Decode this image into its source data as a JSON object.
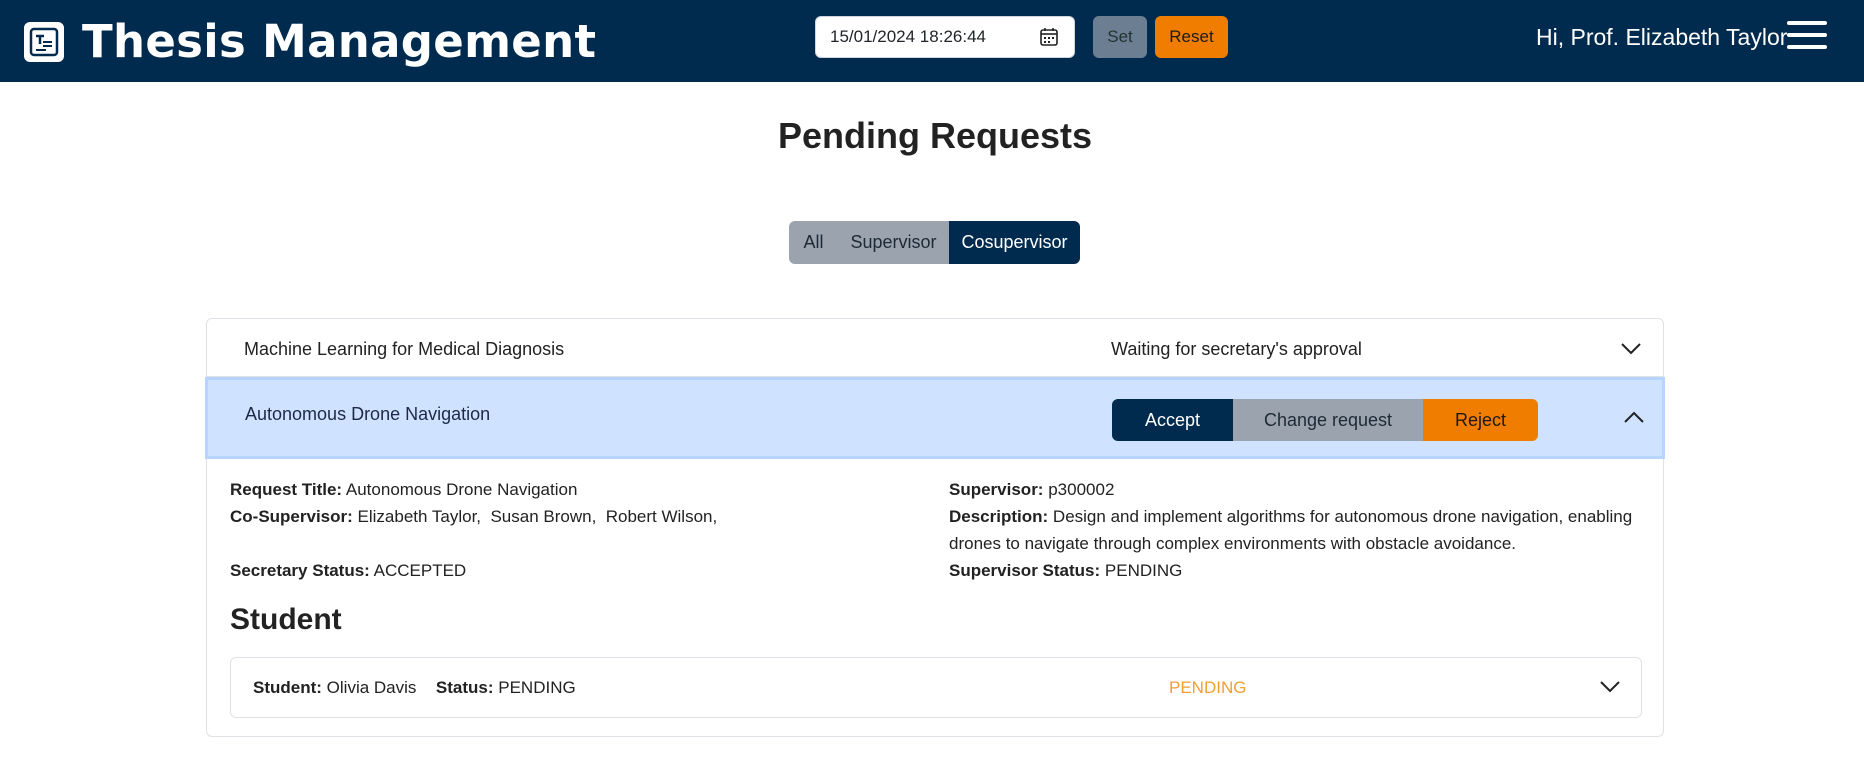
{
  "app": {
    "title": "Thesis Management"
  },
  "header": {
    "date_value": "15/01/2024 18:26:44",
    "set_label": "Set",
    "reset_label": "Reset",
    "greeting": "Hi, Prof. Elizabeth Taylor"
  },
  "page": {
    "title": "Pending Requests"
  },
  "filters": {
    "all": "All",
    "supervisor": "Supervisor",
    "cosupervisor": "Cosupervisor",
    "selected": "Cosupervisor"
  },
  "requests": [
    {
      "title": "Machine Learning for Medical Diagnosis",
      "status": "Waiting for secretary's approval"
    },
    {
      "title": "Autonomous Drone Navigation",
      "actions": {
        "accept": "Accept",
        "change": "Change request",
        "reject": "Reject"
      }
    }
  ],
  "detail": {
    "request_title_label": "Request Title:",
    "request_title_value": "Autonomous Drone Navigation",
    "cosupervisor_label": "Co-Supervisor:",
    "cosupervisor_value": "Elizabeth Taylor,  Susan Brown,  Robert Wilson,",
    "secretary_status_label": "Secretary Status:",
    "secretary_status_value": "ACCEPTED",
    "supervisor_label": "Supervisor:",
    "supervisor_value": "p300002",
    "description_label": "Description:",
    "description_value": "Design and implement algorithms for autonomous drone navigation, enabling drones to navigate through complex environments with obstacle avoidance.",
    "supervisor_status_label": "Supervisor Status:",
    "supervisor_status_value": "PENDING"
  },
  "student_section": {
    "heading": "Student",
    "student_label": "Student:",
    "student_value": "Olivia Davis",
    "status_label": "Status:",
    "status_value": "PENDING",
    "badge": "PENDING"
  },
  "colors": {
    "navy": "#002b4e",
    "orange": "#f07d00",
    "highlight": "#cfe2ff",
    "pending": "#f0a030"
  }
}
